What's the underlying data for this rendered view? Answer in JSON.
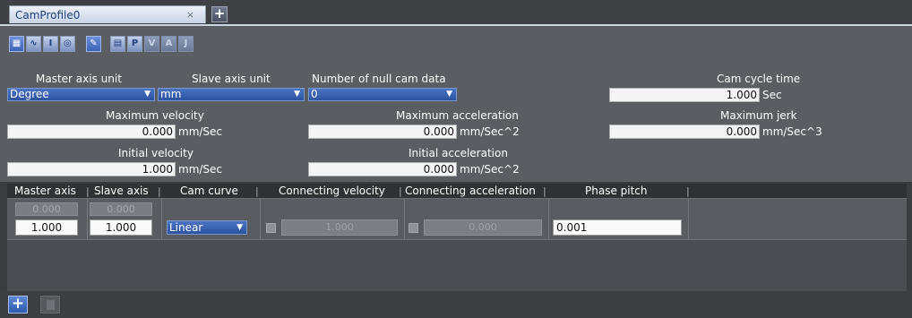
{
  "tab": {
    "title": "CamProfile0",
    "close": "×",
    "add": "+"
  },
  "toolbar": {
    "icons": [
      "table-view-icon",
      "graph-view-icon",
      "cursor-icon",
      "settings-icon",
      "pen-icon",
      "layout-icon",
      "position-icon",
      "velocity-icon",
      "acceleration-icon",
      "jerk-icon"
    ],
    "letters": {
      "p": "P",
      "v": "V",
      "a": "A",
      "j": "J"
    }
  },
  "settings": {
    "master_unit_label": "Master axis unit",
    "master_unit_value": "Degree",
    "slave_unit_label": "Slave axis unit",
    "slave_unit_value": "mm",
    "null_cam_label": "Number of null cam data",
    "null_cam_value": "0",
    "cycle_time_label": "Cam cycle time",
    "cycle_time_value": "1.000",
    "cycle_time_unit": "Sec",
    "max_velocity_label": "Maximum velocity",
    "max_velocity_value": "0.000",
    "max_velocity_unit": "mm/Sec",
    "max_accel_label": "Maximum acceleration",
    "max_accel_value": "0.000",
    "max_accel_unit": "mm/Sec^2",
    "max_jerk_label": "Maximum jerk",
    "max_jerk_value": "0.000",
    "max_jerk_unit": "mm/Sec^3",
    "init_velocity_label": "Initial velocity",
    "init_velocity_value": "1.000",
    "init_velocity_unit": "mm/Sec",
    "init_accel_label": "Initial acceleration",
    "init_accel_value": "0.000",
    "init_accel_unit": "mm/Sec^2"
  },
  "grid": {
    "columns": [
      "Master axis",
      "Slave axis",
      "Cam curve",
      "Connecting velocity",
      "Connecting acceleration",
      "Phase pitch"
    ],
    "ghost_row": {
      "master": "0.000",
      "slave": "0.000"
    },
    "row": {
      "master": "1.000",
      "slave": "1.000",
      "curve": "Linear",
      "conn_velocity": "1.000",
      "conn_accel": "0.000",
      "phase_pitch": "0.001"
    }
  },
  "bottom": {
    "add": "+"
  }
}
